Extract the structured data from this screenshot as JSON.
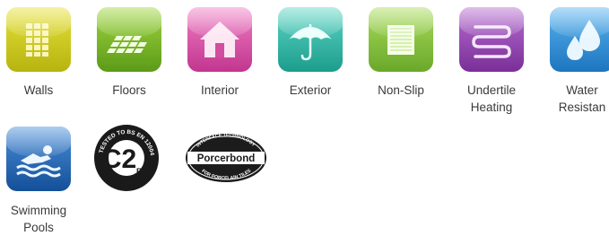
{
  "icons": [
    {
      "id": "walls",
      "label": "Walls",
      "icon": "brick-grid-icon",
      "color": "#c8c81c"
    },
    {
      "id": "floors",
      "label": "Floors",
      "icon": "floor-tiles-icon",
      "color": "#86c02e"
    },
    {
      "id": "interior",
      "label": "Interior",
      "icon": "house-icon",
      "color": "#d64fa6"
    },
    {
      "id": "exterior",
      "label": "Exterior",
      "icon": "umbrella-icon",
      "color": "#2fb8a6"
    },
    {
      "id": "non_slip",
      "label": "Non-Slip",
      "icon": "textured-tile-icon",
      "color": "#8ec63f"
    },
    {
      "id": "undertile_heating",
      "label": "Undertile\nHeating",
      "icon": "heating-coil-icon",
      "color": "#8b43a6"
    },
    {
      "id": "water_resistant",
      "label": "Water\nResistan",
      "icon": "water-drops-icon",
      "color": "#2a8fd6"
    },
    {
      "id": "swimming_pools",
      "label": "Swimming\nPools",
      "icon": "swimmer-icon",
      "color": "#1e5fb0"
    }
  ],
  "certifications": {
    "c2ft": {
      "main": "C2",
      "sub": "FT",
      "ring_text": "TESTED TO BS EN 12004"
    },
    "porcerbond": {
      "name": "Porcerbond",
      "top_text": "INTERFACE TECHNOLOGY",
      "bottom_text": "FOR PORCELAIN TILES"
    }
  }
}
